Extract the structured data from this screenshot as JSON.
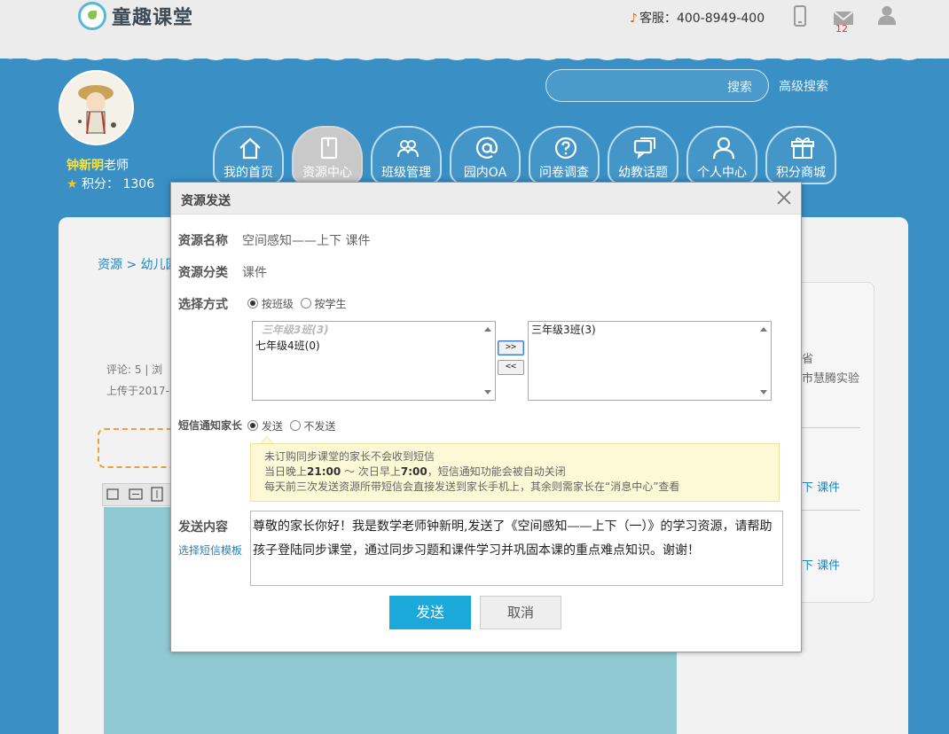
{
  "header": {
    "brand": "童趣课堂",
    "hotline_label": "客服：",
    "hotline_number": "400-8949-400",
    "message_count": "12",
    "search_button": "搜索",
    "advanced_search": "高级搜索"
  },
  "user": {
    "name": "钟新明",
    "role": "老师",
    "points_label": "积分：",
    "points": "1306"
  },
  "nav": [
    {
      "label": "我的首页",
      "icon": "home-icon"
    },
    {
      "label": "资源中心",
      "icon": "book-icon",
      "active": true
    },
    {
      "label": "班级管理",
      "icon": "group-icon"
    },
    {
      "label": "园内OA",
      "icon": "at-icon"
    },
    {
      "label": "问卷调查",
      "icon": "question-icon"
    },
    {
      "label": "幼教话题",
      "icon": "chat-icon"
    },
    {
      "label": "个人中心",
      "icon": "user-icon"
    },
    {
      "label": "积分商城",
      "icon": "gift-icon"
    }
  ],
  "background": {
    "breadcrumb_root": "资源",
    "breadcrumb_sep": " > ",
    "breadcrumb_child": "幼儿园",
    "comments": "评论: 5",
    "meta_extra": "  |  浏",
    "uploaded": "上传于2017-",
    "right_text_1": "省",
    "right_text_2": "市慧腾实验",
    "right_link_1": "下 课件",
    "right_link_2": "下 课件"
  },
  "modal": {
    "title": "资源发送",
    "resource_name_label": "资源名称",
    "resource_name": "空间感知——上下 课件",
    "resource_type_label": "资源分类",
    "resource_type": "课件",
    "select_mode_label": "选择方式",
    "mode_by_class": "按班级",
    "mode_by_student": "按学生",
    "left_list": [
      "三年级3班(3)",
      "七年级4班(0)"
    ],
    "right_list": [
      "三年级3班(3)"
    ],
    "move_right": ">>",
    "move_left": "<<",
    "sms_label": "短信通知家长",
    "sms_send": "发送",
    "sms_no_send": "不发送",
    "notice_line1": "未订购同步课堂的家长不会收到短信",
    "notice_line2_a": "当日晚上",
    "notice_line2_b": "21:00",
    "notice_line2_c": " ～ 次日早上",
    "notice_line2_d": "7:00",
    "notice_line2_e": "，短信通知功能会被自动关闭",
    "notice_line3": "每天前三次发送资源所带短信会直接发送到家长手机上，其余则需家长在“消息中心”查看",
    "content_label": "发送内容",
    "template_link": "选择短信模板",
    "message": "尊敬的家长你好！我是数学老师钟新明,发送了《空间感知——上下（一）》的学习资源，请帮助孩子登陆同步课堂，通过同步习题和课件学习并巩固本课的重点难点知识。谢谢！",
    "send_button": "发送",
    "cancel_button": "取消"
  },
  "colors": {
    "sky": "#3a8fc4",
    "accent": "#1ba9d9",
    "active_nav": "#c9c9c9",
    "username": "#f3e24a",
    "notice_bg": "#fdf8d6"
  }
}
